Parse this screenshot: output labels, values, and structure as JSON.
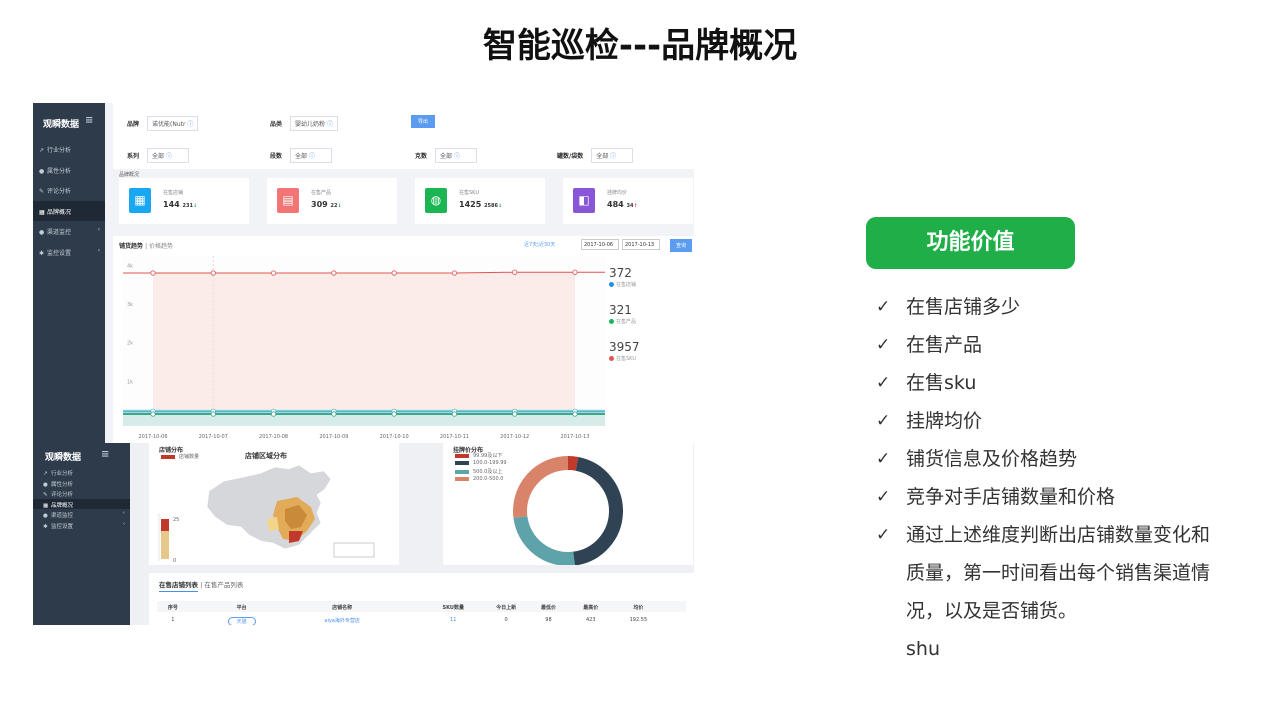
{
  "slide": {
    "title": "智能巡检---品牌概况"
  },
  "dashboard": {
    "logo": "观瞬数据",
    "menu_icon": "≡",
    "nav": [
      {
        "label": "行业分析",
        "icon": "chart-icon"
      },
      {
        "label": "属性分析",
        "icon": "attribute-icon"
      },
      {
        "label": "评论分析",
        "icon": "comment-icon"
      },
      {
        "label": "品牌概况",
        "icon": "brand-icon",
        "active": true
      },
      {
        "label": "渠道监控",
        "icon": "channel-icon",
        "chevron": "‹"
      },
      {
        "label": "监控设置",
        "icon": "settings-icon",
        "chevron": "‹"
      }
    ],
    "filters": {
      "brand_label": "品牌",
      "brand_value": "诺优能(Nutr",
      "category_label": "品类",
      "category_value": "婴幼儿奶粉",
      "export_label": "导出",
      "series_label": "系列",
      "series_value": "全部",
      "stage_label": "段数",
      "stage_value": "全部",
      "gram_label": "克数",
      "gram_value": "全部",
      "pack_label": "罐数/袋数",
      "pack_value": "全部"
    },
    "overview_label": "品牌概况",
    "cards": [
      {
        "label": "在售店铺",
        "value": "144",
        "delta": "231",
        "trend": "down",
        "color": "#18a7f0",
        "icon": "store-icon"
      },
      {
        "label": "在售产品",
        "value": "309",
        "delta": "22",
        "trend": "down",
        "color": "#f37474",
        "icon": "product-icon"
      },
      {
        "label": "在售SKU",
        "value": "1425",
        "delta": "2586",
        "trend": "down",
        "color": "#1bb552",
        "icon": "sku-icon"
      },
      {
        "label": "挂牌均价",
        "value": "484",
        "delta": "34",
        "trend": "up",
        "color": "#8a56d8",
        "icon": "price-icon"
      }
    ],
    "trend": {
      "title": "铺货趋势",
      "subtitle": "| 价格趋势",
      "ranges": "近7天|近30天",
      "date_from": "2017-10-06",
      "date_to": "2017-10-13",
      "query_label": "查询"
    },
    "legend": [
      {
        "value": "372",
        "label": "在售店铺",
        "color": "#1f8fe6"
      },
      {
        "value": "321",
        "label": "在售产品",
        "color": "#1bb552"
      },
      {
        "value": "3957",
        "label": "在售SKU",
        "color": "#e05555"
      }
    ]
  },
  "chart_data": {
    "type": "line",
    "x": [
      "2017-10-06",
      "2017-10-07",
      "2017-10-08",
      "2017-10-09",
      "2017-10-10",
      "2017-10-11",
      "2017-10-12",
      "2017-10-13"
    ],
    "y_ticks": [
      "4k",
      "3k",
      "2k",
      "1k",
      "0"
    ],
    "ylim": [
      0,
      4400
    ],
    "series": [
      {
        "name": "在售SKU",
        "color": "#e05555",
        "values": [
          3960,
          3960,
          3960,
          3960,
          3960,
          3960,
          3980,
          3980
        ]
      },
      {
        "name": "在售店铺",
        "color": "#54b7c9",
        "values": [
          380,
          380,
          380,
          380,
          380,
          380,
          380,
          380
        ]
      },
      {
        "name": "在售产品",
        "color": "#3da78e",
        "values": [
          310,
          310,
          310,
          310,
          310,
          310,
          310,
          310
        ]
      }
    ],
    "grid": false
  },
  "screenshot2": {
    "logo": "观瞬数据",
    "menu_icon": "≡",
    "nav": [
      {
        "label": "行业分析",
        "icon": "chart-icon"
      },
      {
        "label": "属性分析",
        "icon": "attribute-icon"
      },
      {
        "label": "评论分析",
        "icon": "comment-icon"
      },
      {
        "label": "品牌概况",
        "icon": "brand-icon",
        "active": true
      },
      {
        "label": "渠道监控",
        "icon": "channel-icon",
        "chevron": "‹"
      },
      {
        "label": "监控设置",
        "icon": "settings-icon",
        "chevron": "‹"
      }
    ],
    "store_panel": {
      "title": "店铺分布",
      "legend": "店铺数量",
      "map_title": "店铺区域分布",
      "scale_max": "25",
      "scale_min": "0"
    },
    "price_panel": {
      "title": "挂牌价分布",
      "legend": [
        {
          "label": "99.99及以下",
          "color": "#c0392b"
        },
        {
          "label": "100.0-199.99",
          "color": "#2f4354"
        },
        {
          "label": "500.0及以上",
          "color": "#5ea2aa"
        },
        {
          "label": "200.0-500.0",
          "color": "#d9836a"
        }
      ],
      "slices": [
        3,
        45,
        25,
        27
      ]
    },
    "table": {
      "tab_active": "在售店铺列表",
      "tab_other": "| 在售产品列表",
      "headers": [
        "序号",
        "平台",
        "店铺名称",
        "SKU数量",
        "今日上新",
        "最低价",
        "最高价",
        "均价"
      ],
      "row": [
        "1",
        "天猫",
        "aiya海外专营店",
        "11",
        "0",
        "98",
        "423",
        "192.55"
      ]
    }
  },
  "value_panel": {
    "button_label": "功能价值",
    "check": "✓",
    "points": [
      "在售店铺多少",
      "在售产品",
      "在售sku",
      "挂牌均价",
      "铺货信息及价格趋势",
      "竞争对手店铺数量和价格",
      "通过上述维度判断出店铺数量变化和质量，第一时间看出每个销售渠道情况，以及是否铺货。",
      "shu"
    ]
  }
}
